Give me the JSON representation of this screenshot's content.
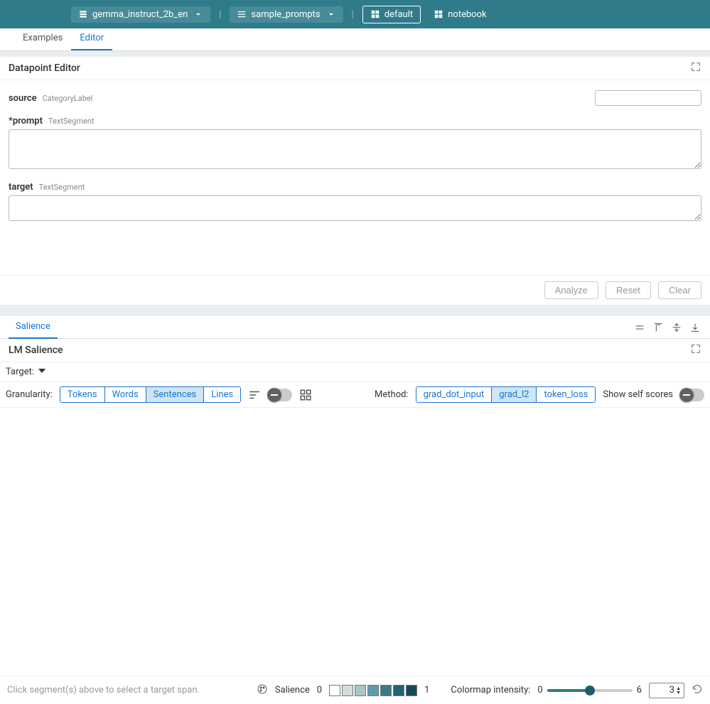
{
  "header": {
    "model_label": "gemma_instruct_2b_en",
    "dataset_label": "sample_prompts",
    "layout_label": "default",
    "notebook_label": "notebook"
  },
  "tabs": {
    "examples": "Examples",
    "editor": "Editor"
  },
  "editor_panel": {
    "title": "Datapoint Editor",
    "fields": {
      "source": {
        "label": "source",
        "type": "CategoryLabel",
        "value": ""
      },
      "prompt": {
        "label": "*prompt",
        "type": "TextSegment",
        "value": ""
      },
      "target": {
        "label": "target",
        "type": "TextSegment",
        "value": ""
      }
    },
    "buttons": {
      "analyze": "Analyze",
      "reset": "Reset",
      "clear": "Clear"
    }
  },
  "salience_tab": "Salience",
  "salience_panel": {
    "title": "LM Salience",
    "target_label": "Target:",
    "granularity_label": "Granularity:",
    "granularity_options": [
      "Tokens",
      "Words",
      "Sentences",
      "Lines"
    ],
    "granularity_active": "Sentences",
    "method_label": "Method:",
    "method_options": [
      "grad_dot_input",
      "grad_l2",
      "token_loss"
    ],
    "method_active": "grad_l2",
    "show_self_scores_label": "Show self scores"
  },
  "footer": {
    "hint": "Click segment(s) above to select a target span.",
    "salience_label": "Salience",
    "scale_min": "0",
    "scale_max": "1",
    "colormap_label": "Colormap intensity:",
    "slider_min": "0",
    "slider_max": "6",
    "slider_value": "3",
    "colors": [
      "#ffffff",
      "#d3dde0",
      "#a8c5cc",
      "#5e9aa7",
      "#3a7a8a",
      "#27606e",
      "#174a58"
    ]
  }
}
